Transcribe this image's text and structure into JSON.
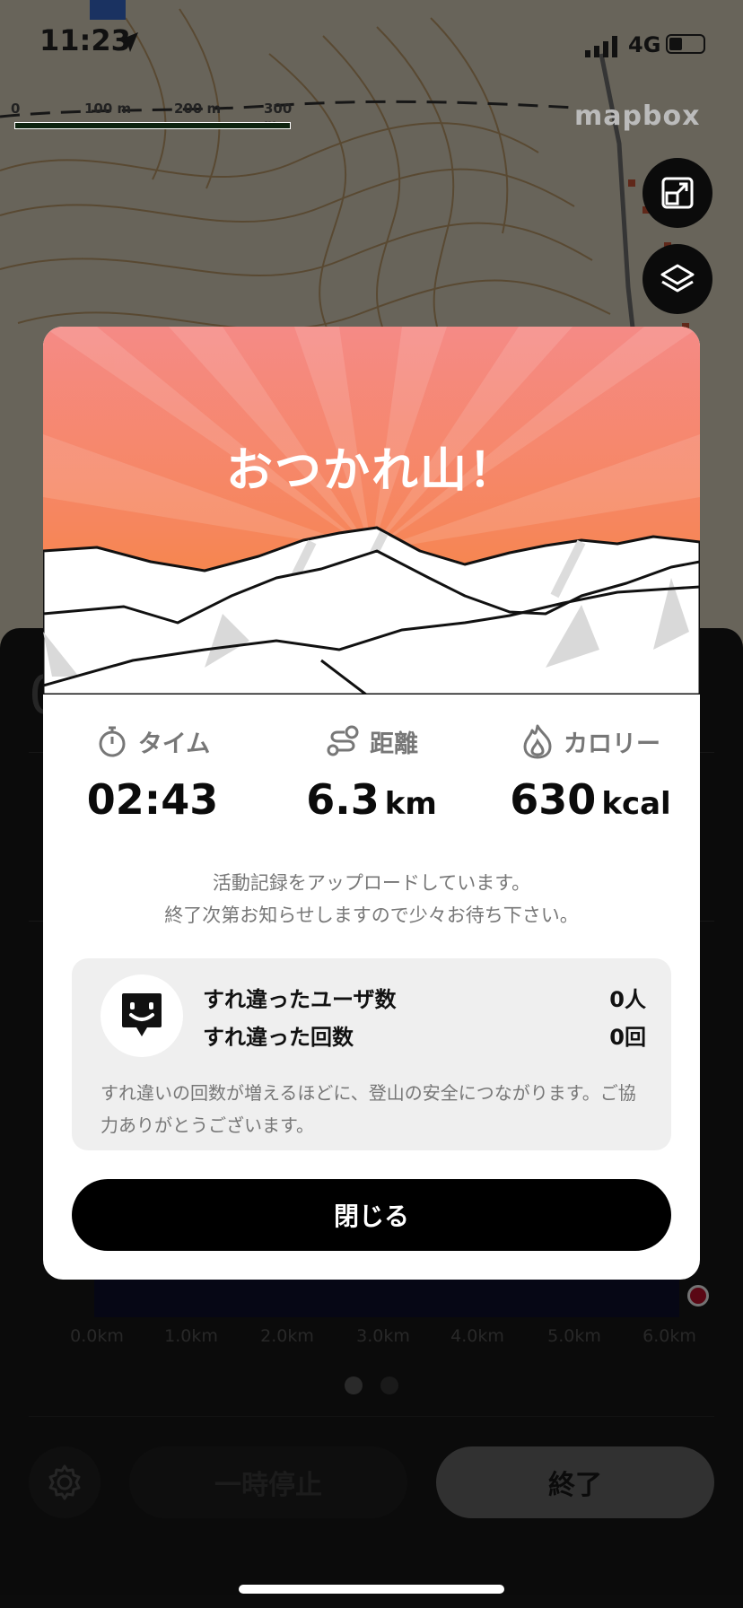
{
  "status_bar": {
    "time": "11:23",
    "network": "4G"
  },
  "map": {
    "scale_labels": [
      "0",
      "100 m",
      "200 m",
      "300 m"
    ],
    "attribution": "mapbox"
  },
  "sheet": {
    "partial_value": "0",
    "x_axis_labels": [
      "0.0km",
      "1.0km",
      "2.0km",
      "3.0km",
      "4.0km",
      "5.0km",
      "6.0km"
    ],
    "pause_label": "一時停止",
    "end_label": "終了"
  },
  "modal": {
    "title": "おつかれ山！",
    "stats": [
      {
        "label": "タイム",
        "value": "02:43",
        "unit": ""
      },
      {
        "label": "距離",
        "value": "6.3",
        "unit": "km"
      },
      {
        "label": "カロリー",
        "value": "630",
        "unit": "kcal"
      }
    ],
    "upload_message_line1": "活動記録をアップロードしています。",
    "upload_message_line2": "終了次第お知らせしますので少々お待ち下さい。",
    "passing": {
      "users_label": "すれ違ったユーザ数",
      "users_value": "0人",
      "count_label": "すれ違った回数",
      "count_value": "0回",
      "note": "すれ違いの回数が増えるほどに、登山の安全につながります。ご協力ありがとうございます。"
    },
    "close_label": "閉じる"
  }
}
